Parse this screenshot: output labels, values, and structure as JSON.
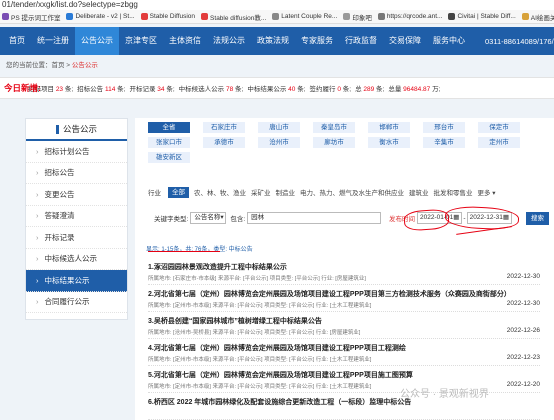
{
  "address": "01/tender/xxgk/list.do?selectype=zbgg",
  "bookmarks": [
    {
      "label": "PS 提示词工作室",
      "color": "#7a4db3"
    },
    {
      "label": "Deliberate - v2 | St...",
      "color": "#2b7bd6"
    },
    {
      "label": "Stable Diffusion",
      "color": "#e23b3b"
    },
    {
      "label": "Stable diffusion教...",
      "color": "#e23b3b"
    },
    {
      "label": "Latent Couple Re...",
      "color": "#888888"
    },
    {
      "label": "印象吧",
      "color": "#999999"
    },
    {
      "label": "https://qrcode.ant...",
      "color": "#777777"
    },
    {
      "label": "Civitai | Stable Diff...",
      "color": "#444444"
    },
    {
      "label": "AI绘画关键词生",
      "color": "#d8a23a"
    }
  ],
  "nav": {
    "items": [
      "首页",
      "统一注册",
      "公告公示",
      "京津专区",
      "主体资信",
      "法规公示",
      "政策法规",
      "专家服务",
      "行政监督",
      "交易保障",
      "服务中心"
    ],
    "active_index": 2,
    "phone": "0311-88614089/176/169"
  },
  "breadcrumb": {
    "prefix": "您的当前位置：首页 >",
    "current": "公告公示"
  },
  "stats": {
    "today": "今日新增:",
    "items": [
      {
        "label": "招标项目",
        "value": "23",
        "unit": "条;"
      },
      {
        "label": "招标公告",
        "value": "114",
        "unit": "条;"
      },
      {
        "label": "开标记录",
        "value": "34",
        "unit": "条;"
      },
      {
        "label": "中标候选人公示",
        "value": "78",
        "unit": "条;"
      },
      {
        "label": "中标结果公示",
        "value": "40",
        "unit": "条;"
      },
      {
        "label": "签约履行",
        "value": "0",
        "unit": "条;"
      },
      {
        "label": "总",
        "value": "289",
        "unit": "条;"
      },
      {
        "label": "总量",
        "value": "96484.87",
        "unit": "万;"
      }
    ]
  },
  "sidebar": {
    "title": "公告公示",
    "items": [
      "招标计划公告",
      "招标公告",
      "变更公告",
      "答疑澄清",
      "开标记录",
      "中标候选人公示",
      "中标结果公示",
      "合同履行公示"
    ],
    "active_index": 6
  },
  "regions": {
    "row1": [
      "全省",
      "石家庄市",
      "唐山市",
      "秦皇岛市",
      "邯郸市",
      "邢台市",
      "保定市"
    ],
    "row2": [
      "张家口市",
      "承德市",
      "沧州市",
      "廊坊市",
      "衡水市",
      "辛集市",
      "定州市"
    ],
    "row3": [
      "雄安新区"
    ]
  },
  "industry": {
    "label": "行业",
    "all": "全部",
    "options": [
      "农、林、牧、渔业",
      "采矿业",
      "制造业",
      "电力、热力、燃气及水生产和供应业",
      "建筑业",
      "批发和零售业",
      "更多 ▾"
    ]
  },
  "search": {
    "type_label": "关键字类型:",
    "type_value": "公告名称",
    "contains_label": "包含:",
    "keyword": "园林",
    "time_label": "发布时间",
    "date_from": "2022-01-01",
    "date_to": "2022-12-31",
    "button": "搜索"
  },
  "result_info": "显示: 1-15条，共: 76条，类型: 中标公告",
  "results": [
    {
      "title": "1.涿沼园园林景观改造提升工程中标结果公示",
      "meta": "所属地市: [石家庄市-市本级] 来源平台: [平台公示] 项目类型: [平台公示] 行业: [房屋建筑业]",
      "date": "2022-12-30"
    },
    {
      "title": "2.河北省第七届（定州）园林博览会定州展园及场馆项目建设工程PPP项目第三方检测技术服务（众赛园及商街部分）",
      "meta": "所属地市: [定州市-市本级] 来源平台: [平台公示] 项目类型: [平台公示] 行业: [土木工程建筑业]",
      "date": "2022-12-30"
    },
    {
      "title": "3.吴桥县创建“国家园林城市”植树增绿工程中标结果公告",
      "meta": "所属地市: [沧州市-吴桥县] 来源平台: [平台公示] 项目类型: [平台公示] 行业: [房屋建筑业]",
      "date": "2022-12-26"
    },
    {
      "title": "4.河北省第七届（定州）园林博览会定州展园及场馆项目建设工程PPP项目工程测绘",
      "meta": "所属地市: [定州市-市本级] 来源平台: [平台公示] 项目类型: [平台公示] 行业: [土木工程建筑业]",
      "date": "2022-12-23"
    },
    {
      "title": "5.河北省第七届（定州）园林博览会定州展园及场馆项目建设工程PPP项目施工图预算",
      "meta": "所属地市: [定州市-市本级] 来源平台: [平台公示] 项目类型: [平台公示] 行业: [土木工程建筑业]",
      "date": "2022-12-20"
    },
    {
      "title": "6.桥西区 2022 年城市园林绿化及配套设施综合更新改造工程（一标段）监理中标公告",
      "meta": "",
      "date": ""
    }
  ],
  "watermark": "公众号 · 景观新视界"
}
